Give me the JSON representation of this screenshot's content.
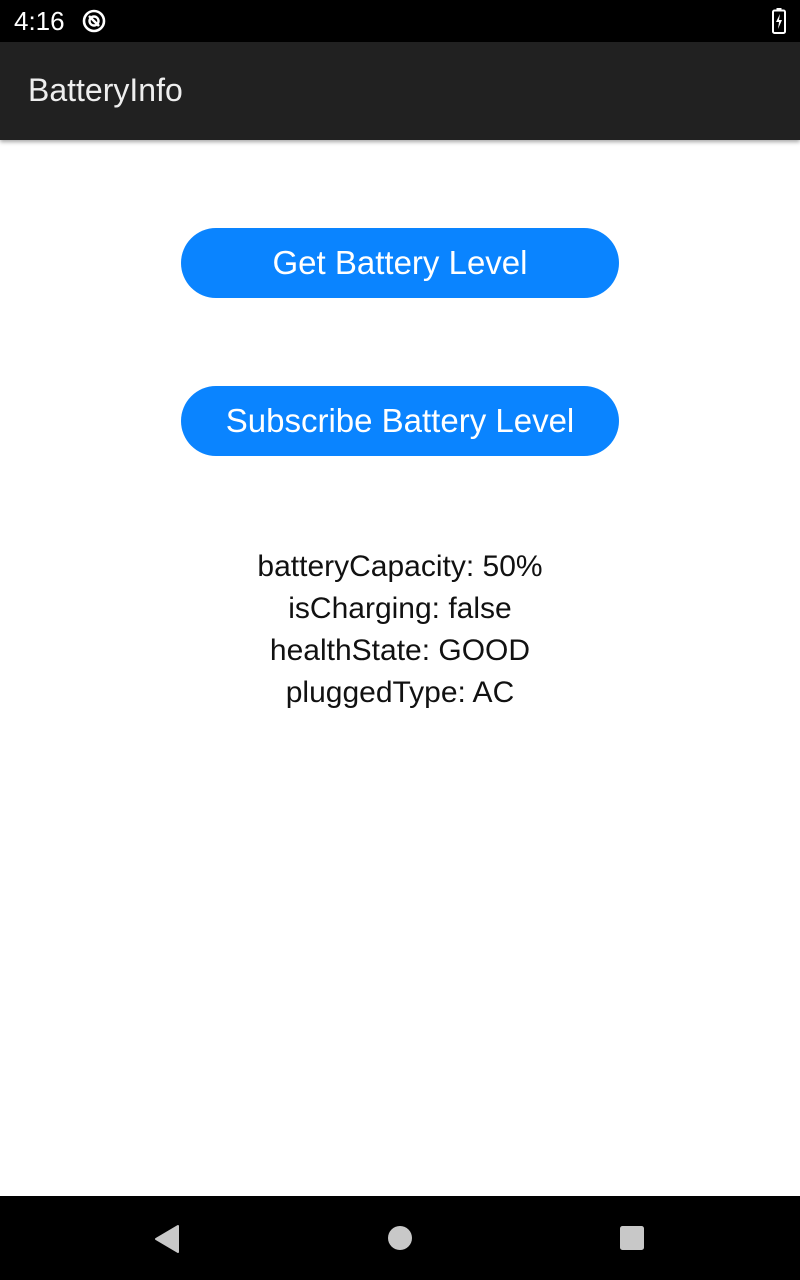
{
  "status_bar": {
    "time": "4:16",
    "app_icon": "app-notification-icon",
    "battery_icon": "battery-charging-icon"
  },
  "app_bar": {
    "title": "BatteryInfo",
    "background_color": "#212121"
  },
  "buttons": {
    "get_battery_level": "Get Battery Level",
    "subscribe_battery_level": "Subscribe Battery Level",
    "color": "#0a84ff"
  },
  "battery_info": {
    "capacity": "batteryCapacity: 50%",
    "is_charging": "isCharging: false",
    "health_state": "healthState: GOOD",
    "plugged_type": "pluggedType: AC"
  },
  "nav_bar": {
    "back_icon": "back-triangle-icon",
    "home_icon": "home-circle-icon",
    "recents_icon": "recents-square-icon"
  }
}
